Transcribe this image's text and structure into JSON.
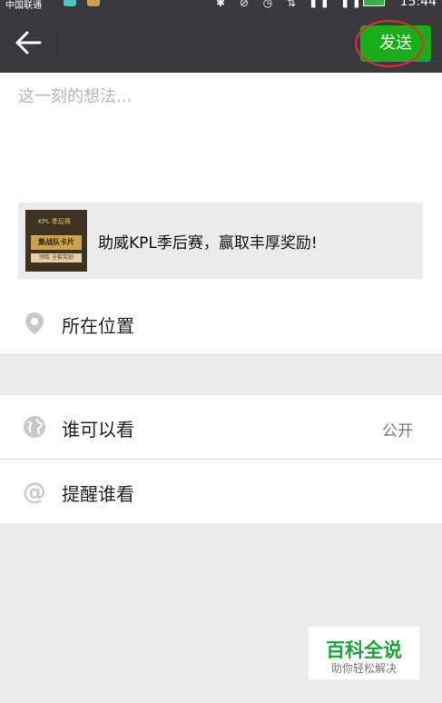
{
  "status_bar": {
    "carrier": "中国联通",
    "time": "15:44"
  },
  "title_bar": {
    "send_label": "发送"
  },
  "compose": {
    "placeholder": "这一刻的想法..."
  },
  "share_card": {
    "title": "助威KPL季后赛，赢取丰厚奖励!",
    "thumb_logo": "KPL 季后赛",
    "thumb_badge": "集战队卡片",
    "thumb_sub": "领取 全套奖励"
  },
  "location": {
    "label": "所在位置"
  },
  "visibility": {
    "label": "谁可以看",
    "value": "公开"
  },
  "remind": {
    "label": "提醒谁看"
  },
  "watermark": {
    "main": "百科全说",
    "sub": "助你轻松解决"
  },
  "colors": {
    "accent_green": "#1aad19",
    "titlebar_bg": "#3a3a3e",
    "highlight_red": "#e0302a"
  }
}
